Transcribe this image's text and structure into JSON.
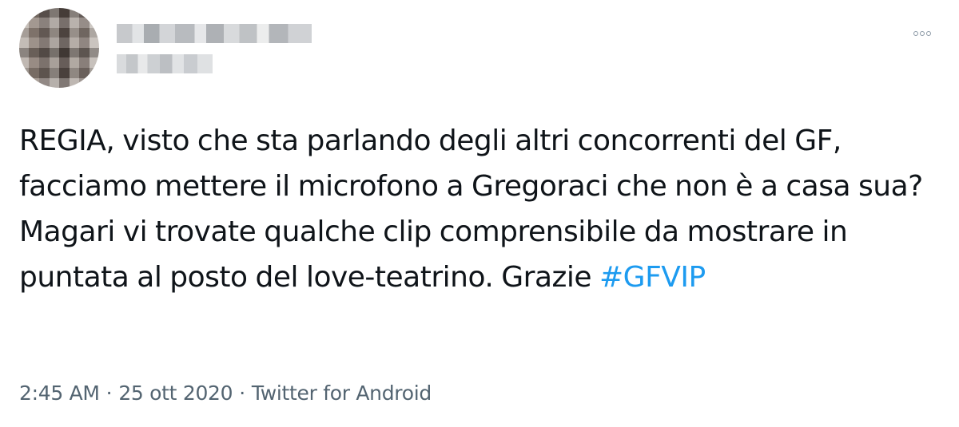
{
  "header": {
    "avatar_icon": "avatar-pixelated",
    "more_icon": "more-options-icon"
  },
  "tweet": {
    "text_before_hashtag": "REGIA, visto che sta parlando degli altri concorrenti del GF, facciamo mettere il microfono a Gregoraci che non è a casa sua? Magari vi trovate qualche clip comprensibile da mostrare in puntata al posto del love-teatrino. Grazie ",
    "hashtag": "#GFVIP"
  },
  "meta": {
    "time": "2:45 AM",
    "separator": "·",
    "date": "25 ott 2020",
    "source": "Twitter for Android"
  },
  "colors": {
    "text": "#0f1419",
    "link": "#1d9bf0",
    "meta": "#536471"
  }
}
